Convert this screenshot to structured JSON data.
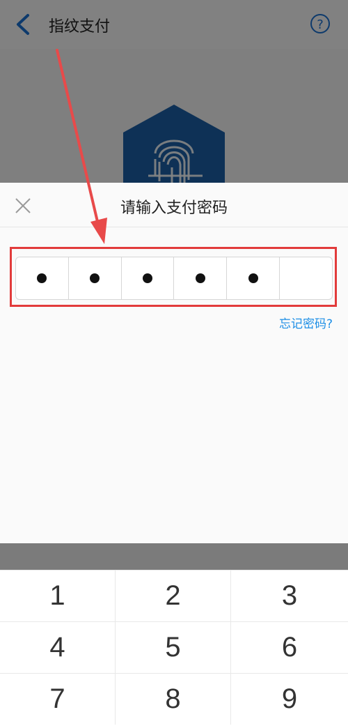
{
  "header": {
    "title": "指纹支付",
    "help_label": "?"
  },
  "sheet": {
    "title": "请输入支付密码",
    "forgot_label": "忘记密码?",
    "pin": {
      "filled": 5,
      "length": 6
    }
  },
  "keypad": {
    "keys": [
      "1",
      "2",
      "3",
      "4",
      "5",
      "6",
      "7",
      "8",
      "9"
    ]
  },
  "colors": {
    "accent": "#1d8fe6",
    "highlight": "#e23b3b",
    "shield": "#1b5fa6"
  },
  "icons": {
    "back": "back-chevron-icon",
    "help": "help-circle-icon",
    "close": "close-icon",
    "fingerprint": "fingerprint-shield-icon"
  }
}
